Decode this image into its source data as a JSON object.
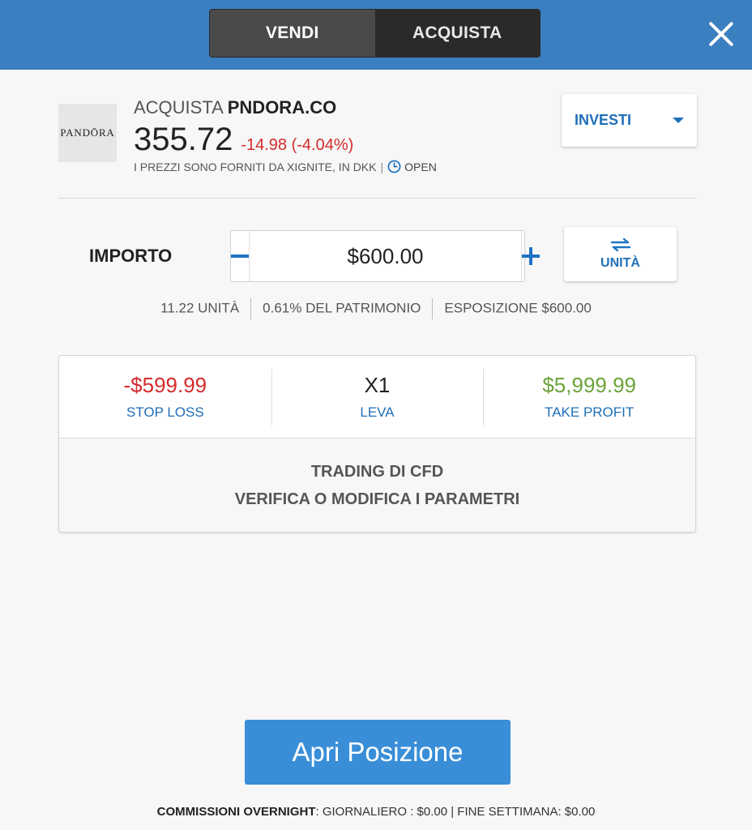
{
  "tabs": {
    "sell": "VENDI",
    "buy": "ACQUISTA"
  },
  "instrument": {
    "logo_text": "PANDŌRA",
    "action": "ACQUISTA",
    "ticker": "PNDORA.CO",
    "price": "355.72",
    "change": "-14.98 (-4.04%)",
    "source": "I PREZZI SONO FORNITI DA XIGNITE, IN DKK",
    "separator": "|",
    "market_status": "OPEN"
  },
  "invest_dropdown": {
    "label": "INVESTI"
  },
  "amount": {
    "label": "IMPORTO",
    "value": "$600.00",
    "units_label": "UNITÀ"
  },
  "stats": {
    "units": "11.22 UNITÀ",
    "equity": "0.61% DEL PATRIMONIO",
    "exposure": "ESPOSIZIONE $600.00"
  },
  "params": {
    "stop_loss": {
      "value": "-$599.99",
      "label": "STOP LOSS"
    },
    "leverage": {
      "value": "X1",
      "label": "LEVA"
    },
    "take_profit": {
      "value": "$5,999.99",
      "label": "TAKE PROFIT"
    },
    "cfd_title": "TRADING DI CFD",
    "cfd_subtitle": "VERIFICA O MODIFICA I PARAMETRI"
  },
  "open_button": {
    "label": "Apri Posizione"
  },
  "fees": {
    "title": "COMMISSIONI OVERNIGHT",
    "daily": ": GIORNALIERO : $0.00 | FINE SETTIMANA: $0.00"
  },
  "colors": {
    "header": "#3a7fbf",
    "accent": "#1f6fb8",
    "negative": "#d42b2b",
    "positive": "#6ba33a",
    "primary_button": "#3a8ed8"
  },
  "icons": {
    "close": "close-icon",
    "clock": "clock-icon",
    "caret": "caret-down-icon",
    "minus": "minus-icon",
    "plus": "plus-icon",
    "swap": "swap-arrows-icon"
  }
}
